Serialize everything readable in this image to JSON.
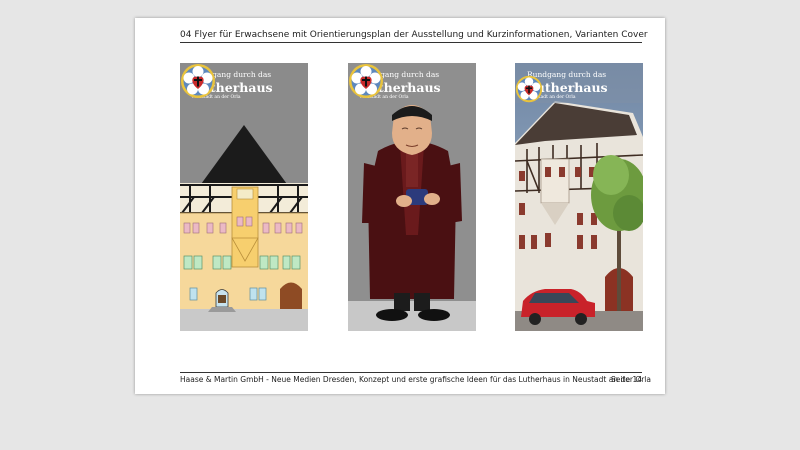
{
  "header": {
    "title": "04 Flyer für Erwachsene mit Orientierungsplan der Ausstellung und Kurzinformationen, Varianten Cover"
  },
  "covers": {
    "line1": "Rundgang durch das",
    "line2": "Lutherhaus",
    "line3": "Neustadt an der Orla"
  },
  "footer": {
    "text": "Haase & Martin GmbH - Neue Medien Dresden, Konzept und erste grafische Ideen für das Lutherhaus in Neustadt an der Orla",
    "page": "Seite 14"
  }
}
